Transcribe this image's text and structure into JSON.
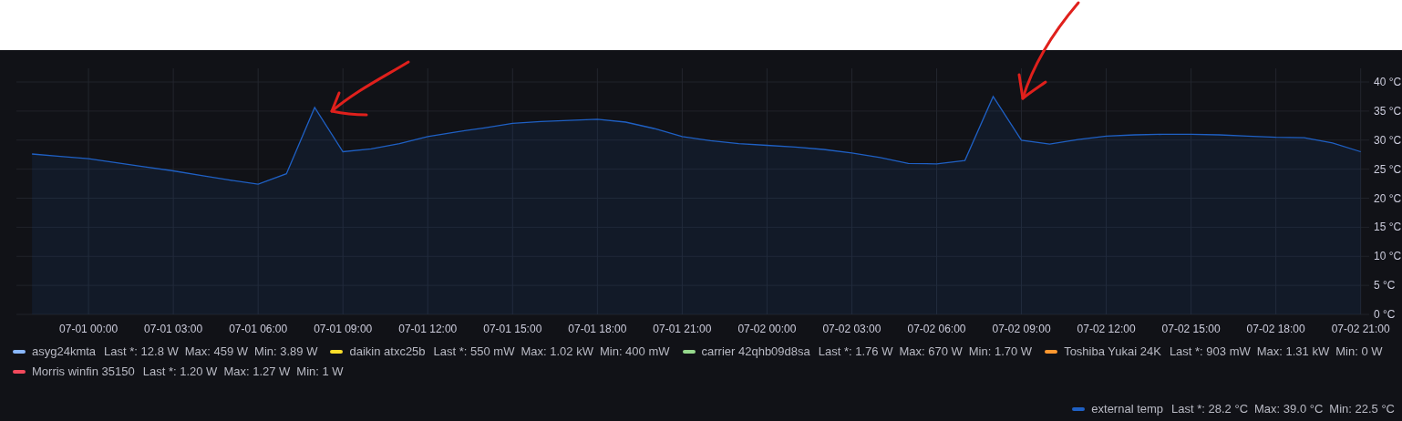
{
  "chart_data": {
    "type": "area",
    "grid": true,
    "ylim": [
      0,
      40
    ],
    "yticks": [
      {
        "value": 0,
        "label": "0 °C"
      },
      {
        "value": 5,
        "label": "5 °C"
      },
      {
        "value": 10,
        "label": "10 °C"
      },
      {
        "value": 15,
        "label": "15 °C"
      },
      {
        "value": 20,
        "label": "20 °C"
      },
      {
        "value": 25,
        "label": "25 °C"
      },
      {
        "value": 30,
        "label": "30 °C"
      },
      {
        "value": 35,
        "label": "35 °C"
      },
      {
        "value": 40,
        "label": "40 °C"
      }
    ],
    "categories": [
      null,
      null,
      "07-01 00:00",
      null,
      null,
      "07-01 03:00",
      null,
      null,
      "07-01 06:00",
      null,
      null,
      "07-01 09:00",
      null,
      null,
      "07-01 12:00",
      null,
      null,
      "07-01 15:00",
      null,
      null,
      "07-01 18:00",
      null,
      null,
      "07-01 21:00",
      null,
      null,
      "07-02 00:00",
      null,
      null,
      "07-02 03:00",
      null,
      null,
      "07-02 06:00",
      null,
      null,
      "07-02 09:00",
      null,
      null,
      "07-02 12:00",
      null,
      null,
      "07-02 15:00",
      null,
      null,
      "07-02 18:00",
      null,
      null,
      "07-02 21:00"
    ],
    "series": [
      {
        "color": "#1f60c4",
        "values": [
          27.6,
          27.2,
          26.8,
          26.1,
          25.4,
          24.7,
          23.9,
          23.1,
          22.4,
          24.2,
          35.6,
          28.0,
          28.5,
          29.4,
          30.6,
          31.4,
          32.1,
          32.9,
          33.2,
          33.4,
          33.6,
          33.1,
          32.0,
          30.6,
          29.9,
          29.4,
          29.1,
          28.8,
          28.4,
          27.8,
          27.0,
          26.0,
          25.9,
          26.5,
          37.5,
          30.0,
          29.3,
          30.1,
          30.7,
          30.9,
          31.0,
          31.0,
          30.9,
          30.7,
          30.5,
          30.4,
          29.5,
          28.0
        ]
      }
    ]
  },
  "legend_rows": [
    [
      {
        "name": "asyg24kmta",
        "color": "#8ab8ff",
        "last": "Last *: 12.8 W",
        "max": "Max: 459 W",
        "min": "Min: 3.89 W"
      },
      {
        "name": "daikin atxc25b",
        "color": "#fade2a",
        "last": "Last *: 550 mW",
        "max": "Max: 1.02 kW",
        "min": "Min: 400 mW"
      },
      {
        "name": "carrier 42qhb09d8sa",
        "color": "#96d98d",
        "last": "Last *: 1.76 W",
        "max": "Max: 670 W",
        "min": "Min: 1.70 W"
      },
      {
        "name": "Toshiba Yukai 24K",
        "color": "#ff9830",
        "last": "Last *: 903 mW",
        "max": "Max: 1.31 kW",
        "min": "Min: 0 W"
      }
    ],
    [
      {
        "name": "Morris winfin 35150",
        "color": "#f2495c",
        "last": "Last *: 1.20 W",
        "max": "Max: 1.27 W",
        "min": "Min: 1 W"
      }
    ]
  ],
  "legend_right": [
    {
      "name": "external temp",
      "color": "#1f60c4",
      "last": "Last *: 28.2 °C",
      "max": "Max: 39.0 °C",
      "min": "Min: 22.5 °C"
    }
  ]
}
